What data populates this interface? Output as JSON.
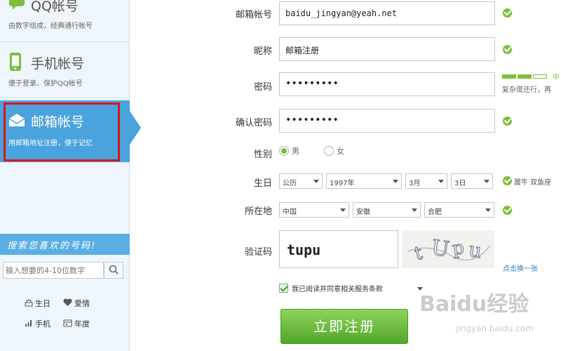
{
  "sidebar": {
    "qq": {
      "title": "QQ帐号",
      "sub": "由数字组成，经典通行帐号"
    },
    "mobile": {
      "title": "手机帐号",
      "sub": "便于登录、保护QQ帐号"
    },
    "email": {
      "title": "邮箱帐号",
      "sub": "用邮箱地址注册，便于记忆"
    },
    "banner": "搜索您喜欢的号码!",
    "search_placeholder": "输入想要的4-10位数字",
    "filters": [
      {
        "label": "生日",
        "icon": "cake-icon"
      },
      {
        "label": "爱情",
        "icon": "heart-icon"
      },
      {
        "label": "手机",
        "icon": "signal-icon"
      },
      {
        "label": "年度",
        "icon": "calendar-icon"
      }
    ]
  },
  "form": {
    "email_label": "邮箱帐号",
    "email_value": "baidu_jingyan@yeah.net",
    "nickname_label": "昵称",
    "nickname_value": "邮箱注册",
    "password_label": "密码",
    "password_value": "•••••••••",
    "strength_mid": "中",
    "strength_hint": "复杂度还行，再",
    "confirm_label": "确认密码",
    "confirm_value": "•••••••••",
    "gender_label": "性别",
    "gender_male": "男",
    "gender_female": "女",
    "birthday_label": "生日",
    "birthday_calendar": "公历",
    "birthday_year": "1997年",
    "birthday_month": "3月",
    "birthday_day": "3日",
    "birthday_hint": "属牛 双鱼座",
    "location_label": "所在地",
    "location_country": "中国",
    "location_province": "安徽",
    "location_city": "合肥",
    "captcha_label": "验证码",
    "captcha_value": "tupu",
    "captcha_refresh": "点击换一张",
    "agree_text": "我已阅读并同意相关服务条款",
    "submit_label": "立即注册"
  },
  "watermark": {
    "brand": "Baidu经验",
    "url": "jingyan.baidu.com"
  },
  "colors": {
    "accent": "#4aa3dc",
    "success": "#7cbf3a",
    "highlight": "#d9161b"
  }
}
